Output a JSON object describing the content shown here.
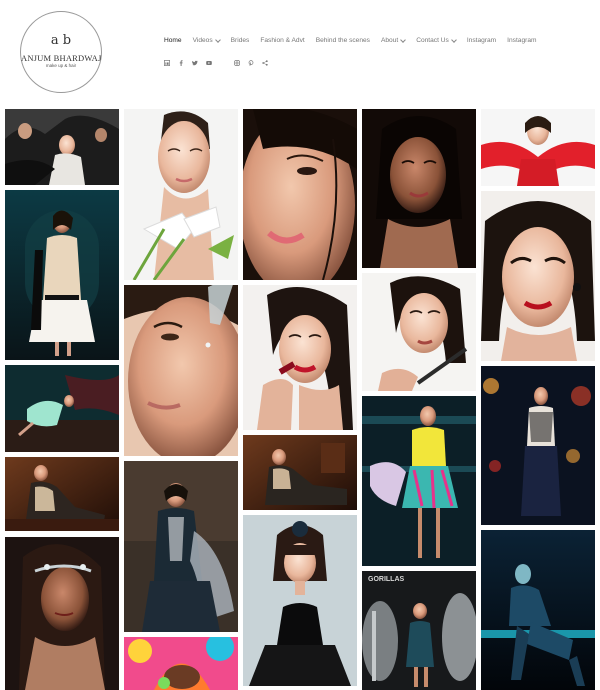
{
  "brand": {
    "monogram": "a b",
    "name": "ANJUM BHARDWAJ",
    "tagline": "make up & hair"
  },
  "nav": [
    {
      "label": "Home",
      "dropdown": false,
      "active": true
    },
    {
      "label": "Videos",
      "dropdown": true,
      "active": false
    },
    {
      "label": "Brides",
      "dropdown": false,
      "active": false
    },
    {
      "label": "Fashion & Advt",
      "dropdown": false,
      "active": false
    },
    {
      "label": "Behind the scenes",
      "dropdown": false,
      "active": false
    },
    {
      "label": "About",
      "dropdown": true,
      "active": false
    },
    {
      "label": "Contact Us",
      "dropdown": true,
      "active": false
    },
    {
      "label": "Instagram",
      "dropdown": false,
      "active": false
    },
    {
      "label": "Instagram",
      "dropdown": false,
      "active": false
    }
  ],
  "social_row_1": [
    "linkedin-icon",
    "facebook-icon",
    "twitter-icon",
    "youtube-icon"
  ],
  "social_row_2": [
    "instagram-icon",
    "pinterest-icon",
    "share-icon"
  ],
  "colors": {
    "nav_text": "#777777",
    "nav_active": "#222222",
    "background": "#ffffff"
  }
}
